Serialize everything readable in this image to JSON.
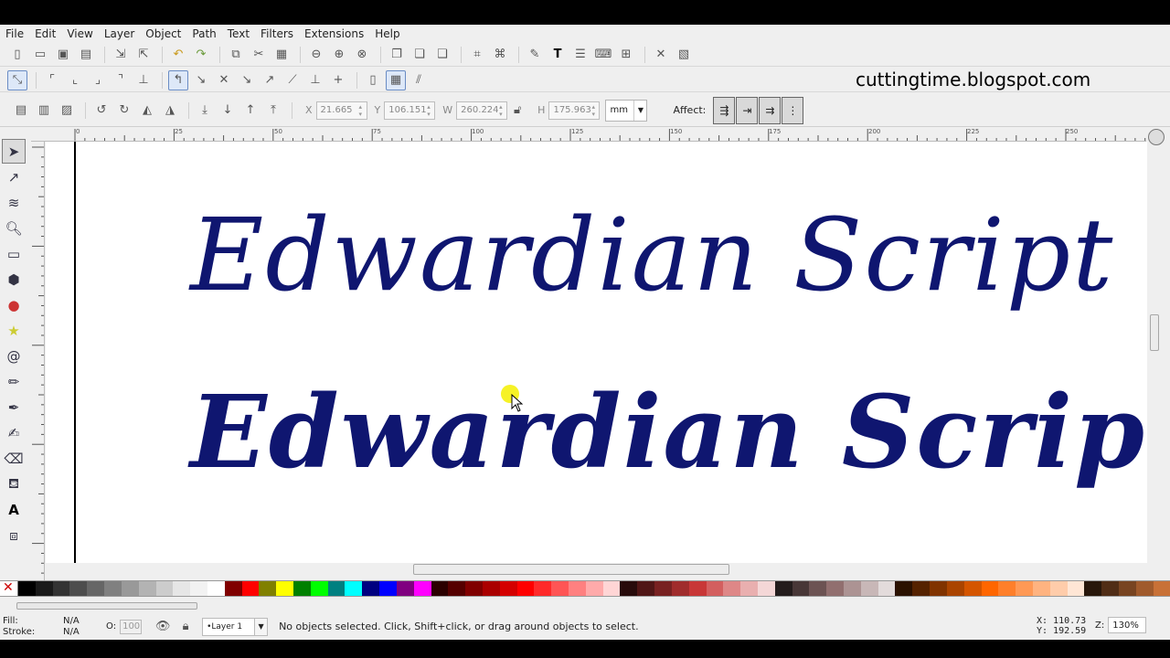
{
  "menubar": {
    "items": [
      "File",
      "Edit",
      "View",
      "Layer",
      "Object",
      "Path",
      "Text",
      "Filters",
      "Extensions",
      "Help"
    ]
  },
  "overlay": {
    "blog_url": "cuttingtime.blogspot.com"
  },
  "controls": {
    "x_label": "X",
    "x_value": "21.665",
    "y_label": "Y",
    "y_value": "106.151",
    "w_label": "W",
    "w_value": "260.224",
    "h_label": "H",
    "h_value": "175.963",
    "unit": "mm",
    "affect_label": "Affect:"
  },
  "canvas": {
    "line1": "Edwardian Script",
    "line2": "Edwardian Script",
    "text_color": "#0f1670"
  },
  "ruler": {
    "h_ticks": [
      "0",
      "25",
      "50",
      "75",
      "100",
      "125",
      "150",
      "175",
      "200",
      "225",
      "250"
    ]
  },
  "palette": {
    "colors": [
      "#000000",
      "#1a1a1a",
      "#333333",
      "#4d4d4d",
      "#666666",
      "#808080",
      "#999999",
      "#b3b3b3",
      "#cccccc",
      "#e6e6e6",
      "#f2f2f2",
      "#ffffff",
      "#800000",
      "#ff0000",
      "#808000",
      "#ffff00",
      "#008000",
      "#00ff00",
      "#008080",
      "#00ffff",
      "#000080",
      "#0000ff",
      "#800080",
      "#ff00ff",
      "#2b0000",
      "#550000",
      "#800000",
      "#aa0000",
      "#d40000",
      "#ff0000",
      "#ff2a2a",
      "#ff5555",
      "#ff8080",
      "#ffaaaa",
      "#ffd5d5",
      "#280b0b",
      "#501616",
      "#782121",
      "#a02c2c",
      "#c83737",
      "#d35f5f",
      "#de8787",
      "#e9afaf",
      "#f4d7d7",
      "#241c1c",
      "#483737",
      "#6c5353",
      "#916f6f",
      "#ac9393",
      "#c8b7b7",
      "#e3dbdb",
      "#2b1100",
      "#552200",
      "#803300",
      "#aa4400",
      "#d45500",
      "#ff6600",
      "#ff7f2a",
      "#ff9955",
      "#ffb380",
      "#ffccaa",
      "#ffe6d5",
      "#28170b",
      "#502d16",
      "#784421",
      "#a05a2c",
      "#c87137"
    ]
  },
  "status": {
    "fill_label": "Fill:",
    "fill_value": "N/A",
    "stroke_label": "Stroke:",
    "stroke_value": "N/A",
    "opacity_label": "O:",
    "opacity_value": "100",
    "layer_name": "•Layer 1",
    "message": "No objects selected. Click, Shift+click, or drag around objects to select.",
    "x_coord": "X:  110.73",
    "y_coord": "Y:  192.59",
    "zoom_label": "Z:",
    "zoom_value": "130%"
  }
}
